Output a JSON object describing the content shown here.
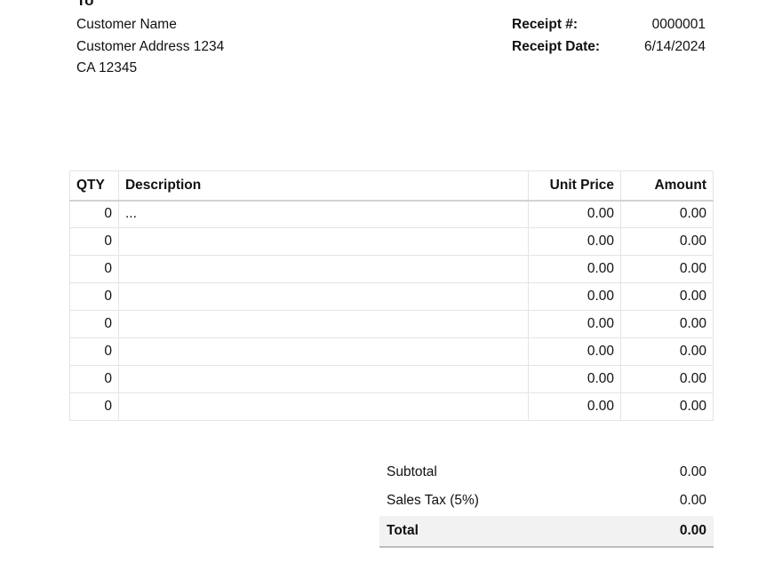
{
  "to_heading": "To",
  "customer": {
    "name": "Customer Name",
    "address": "Customer Address 1234",
    "city_zip": "CA 12345"
  },
  "receipt": {
    "number_label": "Receipt #:",
    "number": "0000001",
    "date_label": "Receipt Date:",
    "date": "6/14/2024"
  },
  "table": {
    "headers": {
      "qty": "QTY",
      "description": "Description",
      "unit_price": "Unit Price",
      "amount": "Amount"
    },
    "rows": [
      {
        "qty": "0",
        "description": "...",
        "unit_price": "0.00",
        "amount": "0.00"
      },
      {
        "qty": "0",
        "description": "",
        "unit_price": "0.00",
        "amount": "0.00"
      },
      {
        "qty": "0",
        "description": "",
        "unit_price": "0.00",
        "amount": "0.00"
      },
      {
        "qty": "0",
        "description": "",
        "unit_price": "0.00",
        "amount": "0.00"
      },
      {
        "qty": "0",
        "description": "",
        "unit_price": "0.00",
        "amount": "0.00"
      },
      {
        "qty": "0",
        "description": "",
        "unit_price": "0.00",
        "amount": "0.00"
      },
      {
        "qty": "0",
        "description": "",
        "unit_price": "0.00",
        "amount": "0.00"
      },
      {
        "qty": "0",
        "description": "",
        "unit_price": "0.00",
        "amount": "0.00"
      }
    ]
  },
  "totals": {
    "subtotal_label": "Subtotal",
    "subtotal": "0.00",
    "tax_label": "Sales Tax (5%)",
    "tax": "0.00",
    "total_label": "Total",
    "total": "0.00"
  }
}
